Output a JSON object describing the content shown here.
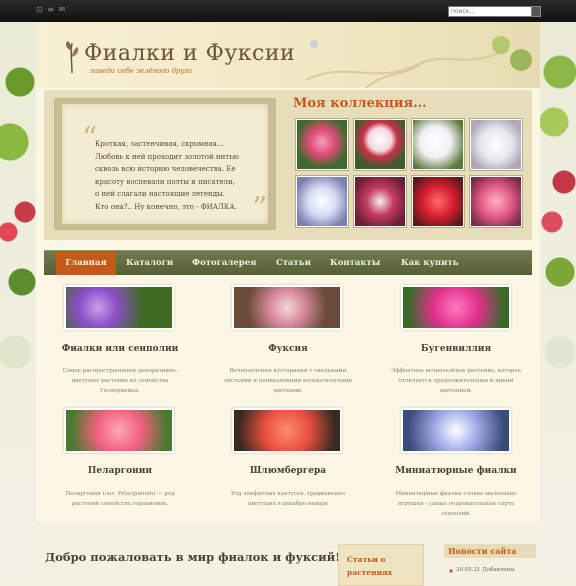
{
  "topbar": {
    "icons_text": "⊡ ≡ ✉",
    "search_placeholder": "поиск..."
  },
  "header": {
    "title": "Фиалки и Фуксии",
    "tagline": "заведи себе зелёного друга"
  },
  "hero": {
    "quote_lines": [
      "Кроткая, застенчивая, скромная...",
      "Любовь к ней проходит золотой нитью",
      "сквозь всю историю человечества. Ее",
      "красоту воспевали поэты и писатели,",
      "о ней слагали настоящие легенды.",
      "Кто она?.. Ну конечно, это - ФИАЛКА."
    ],
    "collection_title": "Моя коллекция..."
  },
  "nav": {
    "items": [
      "Главная",
      "Каталоги",
      "Фотогалерея",
      "Статьи",
      "Контакты",
      "Как купить"
    ]
  },
  "cards": [
    {
      "title": "Фиалки или сенполии",
      "desc": [
        "Самое распространенное декоративно-",
        "цветущее растение из семейства",
        "Геснериевых."
      ]
    },
    {
      "title": "Фуксия",
      "desc": [
        "Вечнозеленые кустарники с овальными",
        "листьями и поникающими колокольчатыми",
        "цветками."
      ]
    },
    {
      "title": "Бугенвиллия",
      "desc": [
        "Эффектное вечнозелёное растение, которое",
        "отличается продолжительным и ярким",
        "цветением."
      ]
    },
    {
      "title": "Пеларгонии",
      "desc": [
        "Пеларгония (лат. Pelargonium) — род",
        "растений семейства гераниевых."
      ]
    },
    {
      "title": "Шлюмбергера",
      "desc": [
        "Род эпифитных кактусов, традиционно",
        "цветущих в декабре-январе"
      ]
    },
    {
      "title": "Миниатюрные фиалки",
      "desc": [
        "Миниатюрные фиалки словно маленькие",
        "игрушки - самые очаровательные сорта",
        "сенполий."
      ]
    }
  ],
  "bottom": {
    "welcome": "Добро пожаловать в мир фиалок и фуксий!",
    "articles_label": "Статьи о растениях",
    "news_title": "Новости сайта",
    "news_item": "30.05.21 Добавлены"
  },
  "colors": {
    "accent": "#c45a18",
    "nav_bg": "#6f7a4d",
    "title_brown": "#6b5136"
  },
  "icons": [
    "search-icon",
    "logo-flower-icon",
    "quote-open-icon",
    "quote-close-icon",
    "bullet-icon"
  ]
}
